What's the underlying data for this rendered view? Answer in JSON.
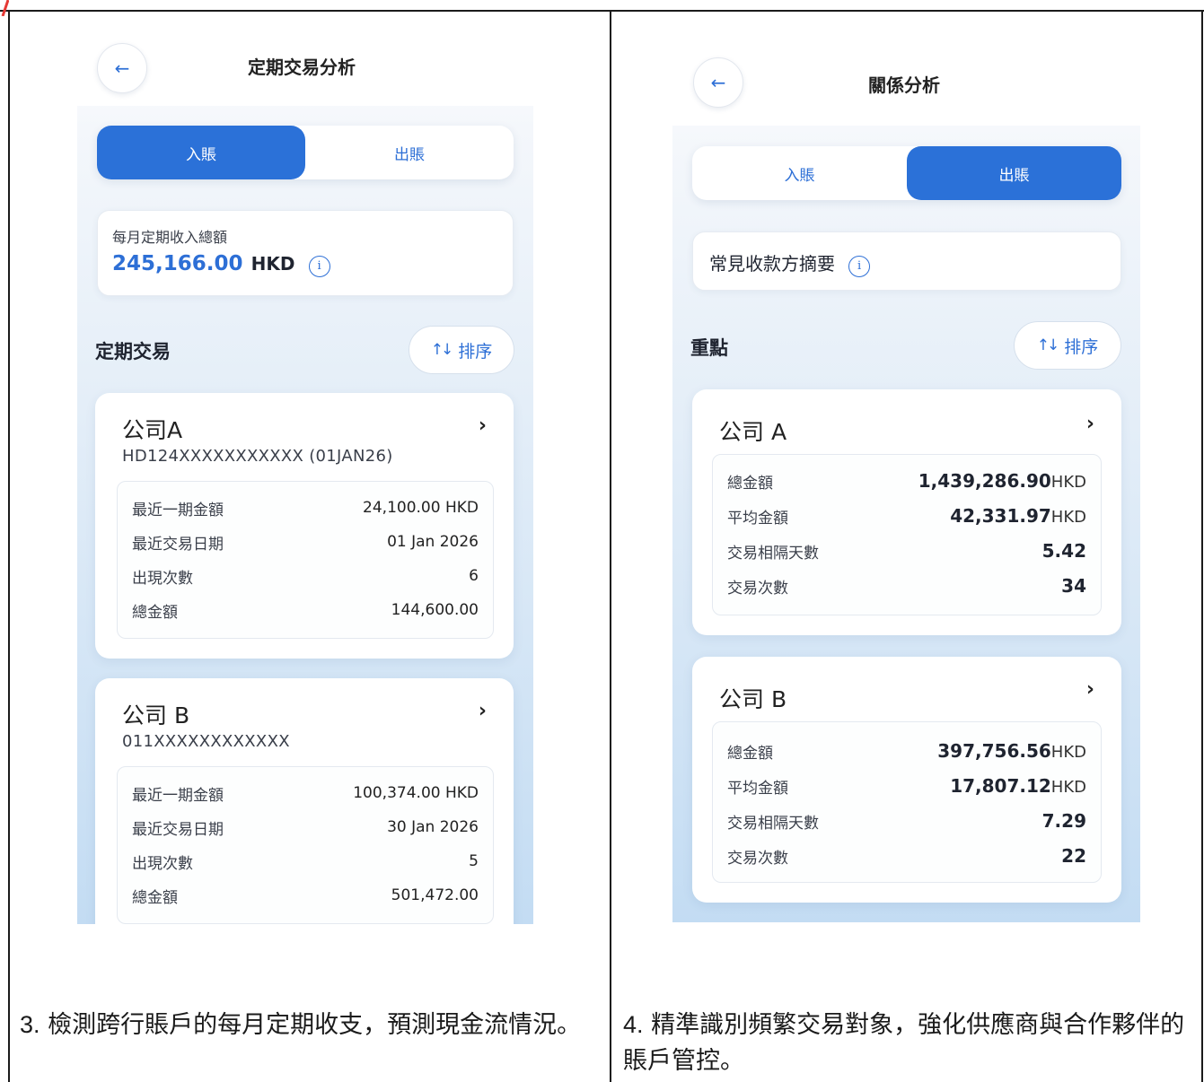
{
  "left": {
    "title": "定期交易分析",
    "tabs": [
      {
        "label": "入賬",
        "active": true
      },
      {
        "label": "出賬",
        "active": false
      }
    ],
    "summary": {
      "label": "每月定期收入總額",
      "amount": "245,166.00",
      "currency": "HKD"
    },
    "section_title": "定期交易",
    "sort_label": "排序",
    "cards": [
      {
        "name": "公司A",
        "account": "HD124XXXXXXXXXXX (01JAN26)",
        "rows": [
          {
            "label": "最近一期金額",
            "value": "24,100.00 HKD"
          },
          {
            "label": "最近交易日期",
            "value": "01 Jan 2026"
          },
          {
            "label": "出現次數",
            "value": "6"
          },
          {
            "label": "總金額",
            "value": "144,600.00"
          }
        ]
      },
      {
        "name": "公司 B",
        "account": "011XXXXXXXXXXXX",
        "rows": [
          {
            "label": "最近一期金額",
            "value": "100,374.00 HKD"
          },
          {
            "label": "最近交易日期",
            "value": "30 Jan 2026"
          },
          {
            "label": "出現次數",
            "value": "5"
          },
          {
            "label": "總金額",
            "value": "501,472.00"
          }
        ]
      }
    ],
    "caption_num": "3.",
    "caption_text": "檢測跨行賬戶的每月定期收支，預測現金流情況。"
  },
  "right": {
    "title": "關係分析",
    "tabs": [
      {
        "label": "入賬",
        "active": false
      },
      {
        "label": "出賬",
        "active": true
      }
    ],
    "summary": {
      "label": "常見收款方摘要"
    },
    "section_title": "重點",
    "sort_label": "排序",
    "cards": [
      {
        "name": "公司 A",
        "rows": [
          {
            "label": "總金額",
            "value": "1,439,286.90",
            "unit": "HKD"
          },
          {
            "label": "平均金額",
            "value": "42,331.97",
            "unit": "HKD"
          },
          {
            "label": "交易相隔天數",
            "value": "5.42",
            "unit": ""
          },
          {
            "label": "交易次數",
            "value": "34",
            "unit": ""
          }
        ]
      },
      {
        "name": "公司 B",
        "rows": [
          {
            "label": "總金額",
            "value": "397,756.56",
            "unit": "HKD"
          },
          {
            "label": "平均金額",
            "value": "17,807.12",
            "unit": "HKD"
          },
          {
            "label": "交易相隔天數",
            "value": "7.29",
            "unit": ""
          },
          {
            "label": "交易次數",
            "value": "22",
            "unit": ""
          }
        ]
      }
    ],
    "caption_num": "4.",
    "caption_text": "精準識別頻繁交易對象，強化供應商與合作夥伴的賬戶管控。"
  },
  "icons": {
    "back": "back-arrow-icon",
    "info": "info-icon",
    "sort": "sort-arrows-icon",
    "chevron": "chevron-right-icon"
  },
  "colors": {
    "accent": "#2b71d8",
    "amount": "#2d6fd6"
  }
}
